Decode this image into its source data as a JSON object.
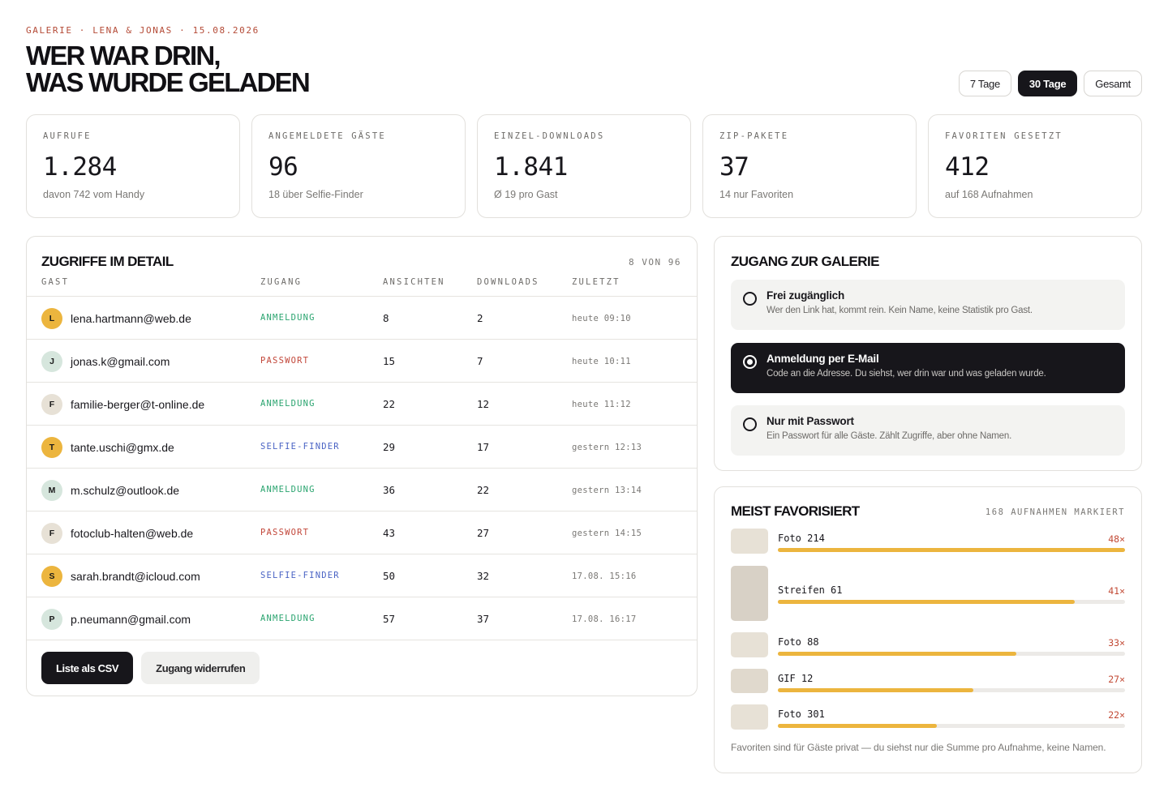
{
  "header": {
    "breadcrumb": "GALERIE · LENA & JONAS · 15.08.2026",
    "title_line1": "WER WAR DRIN,",
    "title_line2": "WAS WURDE GELADEN"
  },
  "range": {
    "options": [
      "7 Tage",
      "30 Tage",
      "Gesamt"
    ],
    "selected": "30 Tage"
  },
  "stats": [
    {
      "label": "AUFRUFE",
      "value": "1.284",
      "sub": "davon 742 vom Handy"
    },
    {
      "label": "ANGEMELDETE GÄSTE",
      "value": "96",
      "sub": "18 über Selfie-Finder"
    },
    {
      "label": "EINZEL-DOWNLOADS",
      "value": "1.841",
      "sub": "Ø 19 pro Gast"
    },
    {
      "label": "ZIP-PAKETE",
      "value": "37",
      "sub": "14 nur Favoriten"
    },
    {
      "label": "FAVORITEN GESETZT",
      "value": "412",
      "sub": "auf 168 Aufnahmen"
    }
  ],
  "access": {
    "title": "ZUGRIFFE IM DETAIL",
    "count": "8 VON 96",
    "columns": [
      "GAST",
      "ZUGANG",
      "ANSICHTEN",
      "DOWNLOADS",
      "ZULETZT"
    ],
    "rows": [
      {
        "initial": "L",
        "avatar_color": "#ecb53e",
        "email": "lena.hartmann@web.de",
        "access": "ANMELDUNG",
        "access_color": "#2aa46f",
        "views": "8",
        "downloads": "2",
        "last": "heute 09:10"
      },
      {
        "initial": "J",
        "avatar_color": "#d6e6dd",
        "email": "jonas.k@gmail.com",
        "access": "PASSWORT",
        "access_color": "#c2473a",
        "views": "15",
        "downloads": "7",
        "last": "heute 10:11"
      },
      {
        "initial": "F",
        "avatar_color": "#e7e1d6",
        "email": "familie-berger@t-online.de",
        "access": "ANMELDUNG",
        "access_color": "#2aa46f",
        "views": "22",
        "downloads": "12",
        "last": "heute 11:12"
      },
      {
        "initial": "T",
        "avatar_color": "#ecb53e",
        "email": "tante.uschi@gmx.de",
        "access": "SELFIE-FINDER",
        "access_color": "#4a63c4",
        "views": "29",
        "downloads": "17",
        "last": "gestern 12:13"
      },
      {
        "initial": "M",
        "avatar_color": "#d6e6dd",
        "email": "m.schulz@outlook.de",
        "access": "ANMELDUNG",
        "access_color": "#2aa46f",
        "views": "36",
        "downloads": "22",
        "last": "gestern 13:14"
      },
      {
        "initial": "F",
        "avatar_color": "#e7e1d6",
        "email": "fotoclub-halten@web.de",
        "access": "PASSWORT",
        "access_color": "#c2473a",
        "views": "43",
        "downloads": "27",
        "last": "gestern 14:15"
      },
      {
        "initial": "S",
        "avatar_color": "#ecb53e",
        "email": "sarah.brandt@icloud.com",
        "access": "SELFIE-FINDER",
        "access_color": "#4a63c4",
        "views": "50",
        "downloads": "32",
        "last": "17.08. 15:16"
      },
      {
        "initial": "P",
        "avatar_color": "#d6e6dd",
        "email": "p.neumann@gmail.com",
        "access": "ANMELDUNG",
        "access_color": "#2aa46f",
        "views": "57",
        "downloads": "37",
        "last": "17.08. 16:17"
      }
    ],
    "csv_label": "Liste als CSV",
    "revoke_label": "Zugang widerrufen"
  },
  "gallery_access": {
    "title": "ZUGANG ZUR GALERIE",
    "options": [
      {
        "title": "Frei zugänglich",
        "desc": "Wer den Link hat, kommt rein. Kein Name, keine Statistik pro Gast.",
        "selected": false
      },
      {
        "title": "Anmeldung per E-Mail",
        "desc": "Code an die Adresse. Du siehst, wer drin war und was geladen wurde.",
        "selected": true
      },
      {
        "title": "Nur mit Passwort",
        "desc": "Ein Passwort für alle Gäste. Zählt Zugriffe, aber ohne Namen.",
        "selected": false
      }
    ]
  },
  "favorites": {
    "title": "MEIST FAVORISIERT",
    "count": "168 AUFNAHMEN MARKIERT",
    "items": [
      {
        "name": "Foto 214",
        "count": "48×",
        "share": 1.0,
        "thumb_color": "#e7e1d6"
      },
      {
        "name": "Streifen 61",
        "count": "41×",
        "share": 0.854,
        "thumb_color": "#d8d1c6"
      },
      {
        "name": "Foto 88",
        "count": "33×",
        "share": 0.688,
        "thumb_color": "#e7e1d6"
      },
      {
        "name": "GIF 12",
        "count": "27×",
        "share": 0.5625,
        "thumb_color": "#e0d9cd"
      },
      {
        "name": "Foto 301",
        "count": "22×",
        "share": 0.458,
        "thumb_color": "#e7e1d6"
      }
    ],
    "note": "Favoriten sind für Gäste privat — du siehst nur die Summe pro Aufnahme, keine Namen."
  }
}
